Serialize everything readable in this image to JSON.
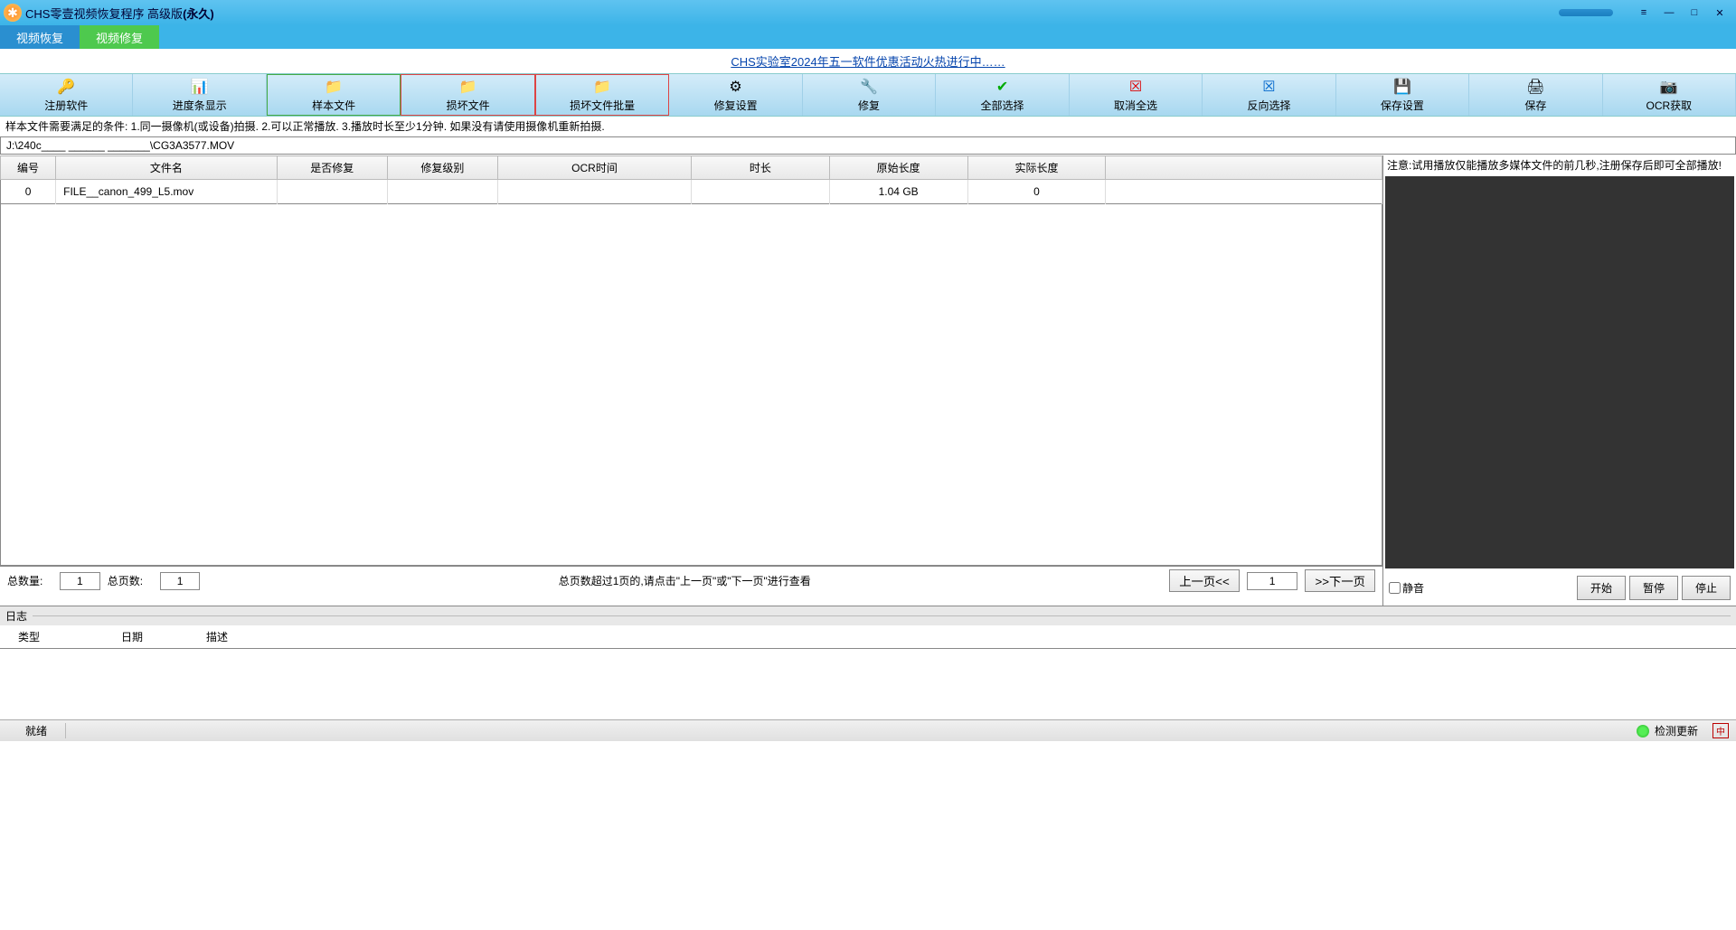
{
  "title": {
    "main": "CHS零壹视频恢复程序 高级版",
    "suffix": "(永久)"
  },
  "winBtns": {
    "menu": "≡",
    "min": "—",
    "max": "□",
    "close": "✕"
  },
  "tabs": {
    "video_recover": "视频恢复",
    "video_repair": "视频修复"
  },
  "promo": "CHS实验室2024年五一软件优惠活动火热进行中……",
  "toolbar": [
    {
      "name": "register-software",
      "icon": "🔑",
      "label": "注册软件"
    },
    {
      "name": "progressbar-show",
      "icon": "📊",
      "label": "进度条显示"
    },
    {
      "name": "sample-file",
      "icon": "📁",
      "label": "样本文件",
      "hl": "green"
    },
    {
      "name": "corrupt-file",
      "icon": "📁",
      "label": "损坏文件",
      "hl": "red"
    },
    {
      "name": "corrupt-file-batch",
      "icon": "📁",
      "label": "损坏文件批量",
      "hl": "red"
    },
    {
      "name": "repair-settings",
      "icon": "⚙",
      "label": "修复设置"
    },
    {
      "name": "repair",
      "icon": "🔧",
      "label": "修复"
    },
    {
      "name": "select-all",
      "icon": "✔",
      "label": "全部选择"
    },
    {
      "name": "deselect-all",
      "icon": "☒",
      "label": "取消全选"
    },
    {
      "name": "invert-selection",
      "icon": "☒",
      "label": "反向选择"
    },
    {
      "name": "save-settings",
      "icon": "💾",
      "label": "保存设置"
    },
    {
      "name": "save",
      "icon": "🖨",
      "label": "保存"
    },
    {
      "name": "ocr-extract",
      "icon": "📷",
      "label": "OCR获取"
    }
  ],
  "info_text": "样本文件需要满足的条件: 1.同一摄像机(或设备)拍摄. 2.可以正常播放. 3.播放时长至少1分钟.  如果没有请使用摄像机重新拍摄.",
  "path": "J:\\240c____ ______ _______\\CG3A3577.MOV",
  "columns": {
    "idx": "编号",
    "fn": "文件名",
    "repaired": "是否修复",
    "level": "修复级别",
    "ocr": "OCR时间",
    "dur": "时长",
    "orig": "原始长度",
    "real": "实际长度"
  },
  "rows": [
    {
      "idx": "0",
      "fn": "FILE__canon_499_L5.mov",
      "repaired": "",
      "level": "",
      "ocr": "",
      "dur": "",
      "orig": "1.04 GB",
      "real": "0"
    }
  ],
  "paging": {
    "total_count_label": "总数量:",
    "total_count": "1",
    "total_pages_label": "总页数:",
    "total_pages": "1",
    "hint": "总页数超过1页的,请点击\"上一页\"或\"下一页\"进行查看",
    "prev": "上一页<<",
    "page": "1",
    "next": ">>下一页"
  },
  "preview": {
    "hint": "注意:试用播放仅能播放多媒体文件的前几秒,注册保存后即可全部播放!",
    "mute": "静音",
    "start": "开始",
    "pause": "暂停",
    "stop": "停止"
  },
  "log": {
    "title": "日志",
    "col_type": "类型",
    "col_date": "日期",
    "col_desc": "描述"
  },
  "status": {
    "ready": "就绪",
    "check_update": "检测更新",
    "ime": "中"
  }
}
